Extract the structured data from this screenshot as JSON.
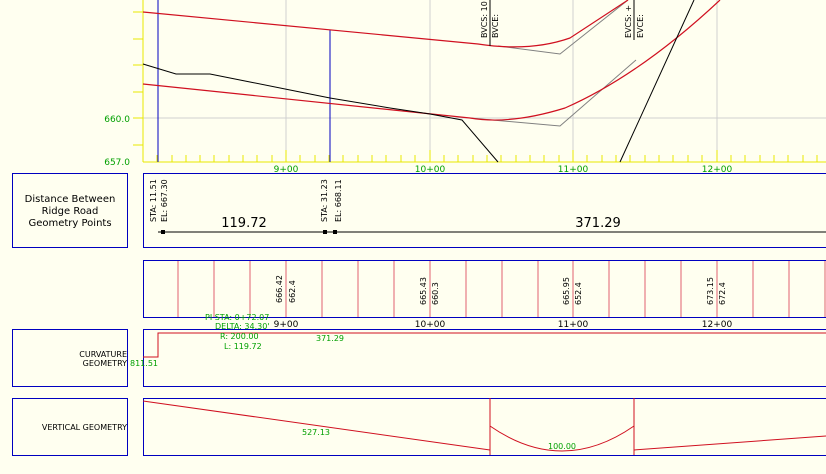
{
  "profile": {
    "elevations": [
      "660.0",
      "657.0"
    ],
    "stations": [
      "9+00",
      "10+00",
      "11+00",
      "12+00"
    ],
    "annotations": [
      "BVCS: 10",
      "BVCE:",
      "EVCS: +",
      "EVCE:"
    ]
  },
  "distance_band": {
    "title_lines": [
      "Distance Between",
      "Ridge Road",
      "Geometry Points"
    ],
    "point1": {
      "sta": "STA: 11.51",
      "el": "EL: 667.30"
    },
    "point2": {
      "sta": "STA: 31.23",
      "el": "EL: 668.11"
    },
    "dist1": "119.72",
    "dist2": "371.29"
  },
  "elevation_band": {
    "values": [
      [
        "666.42",
        "662.4"
      ],
      [
        "665.43",
        "660.3"
      ],
      [
        "665.95",
        "652.4"
      ],
      [
        "673.15",
        "672.4"
      ]
    ],
    "stations": [
      "9+00",
      "10+00",
      "11+00",
      "12+00"
    ]
  },
  "curvature_band": {
    "title_lines": [
      "CURVATURE",
      "GEOMETRY"
    ],
    "pi_sta": "PI STA: 0+72.07",
    "delta": "DELTA: 34.30'",
    "radius": "R: 200.00",
    "length": "L: 119.72",
    "tangent": "371.29",
    "start": "811.51"
  },
  "vertical_band": {
    "title": "VERTICAL GEOMETRY",
    "grade_length": "527.13",
    "vc_length": "100.00"
  },
  "colors": {
    "background": "#fffff0",
    "frame": "#0000c0",
    "grid": "#d0d0d0",
    "tick": "#e8e800",
    "red": "#d01020",
    "green": "#00a000",
    "text": "#000000"
  }
}
